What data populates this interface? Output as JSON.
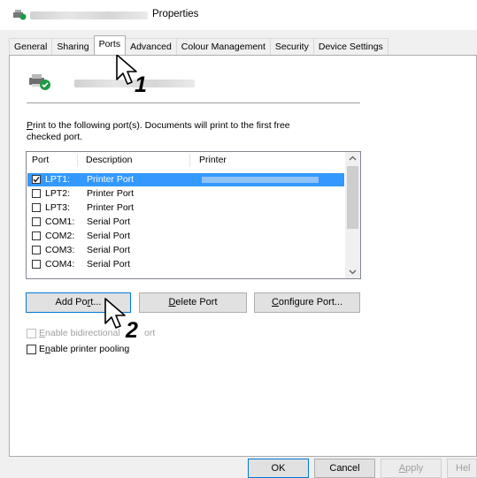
{
  "window": {
    "title_suffix": "Properties",
    "tabs": [
      {
        "label": "General"
      },
      {
        "label": "Sharing"
      },
      {
        "label": "Ports"
      },
      {
        "label": "Advanced"
      },
      {
        "label": "Colour Management"
      },
      {
        "label": "Security"
      },
      {
        "label": "Device Settings"
      }
    ],
    "active_tab": "Ports"
  },
  "ports_tab": {
    "instruction_line1_key": "P",
    "instruction_line1_rest": "rint to the following port(s). Documents will print to the first free",
    "instruction_line2": "checked port.",
    "columns": [
      "Port",
      "Description",
      "Printer"
    ],
    "rows": [
      {
        "port": "LPT1:",
        "description": "Printer Port",
        "checked": true,
        "selected": true
      },
      {
        "port": "LPT2:",
        "description": "Printer Port",
        "checked": false,
        "selected": false
      },
      {
        "port": "LPT3:",
        "description": "Printer Port",
        "checked": false,
        "selected": false
      },
      {
        "port": "COM1:",
        "description": "Serial Port",
        "checked": false,
        "selected": false
      },
      {
        "port": "COM2:",
        "description": "Serial Port",
        "checked": false,
        "selected": false
      },
      {
        "port": "COM3:",
        "description": "Serial Port",
        "checked": false,
        "selected": false
      },
      {
        "port": "COM4:",
        "description": "Serial Port",
        "checked": false,
        "selected": false
      }
    ],
    "buttons": {
      "add_pre": "Add Po",
      "add_key": "r",
      "add_post": "t...",
      "delete_key": "D",
      "delete_post": "elete Port",
      "configure_key": "C",
      "configure_post": "onfigure Port..."
    },
    "bidirectional": {
      "key": "E",
      "rest": "nable bidirectional",
      "tail": "ort",
      "checked": false,
      "enabled": false
    },
    "pooling": {
      "pre": "E",
      "key": "n",
      "post": "able printer pooling",
      "checked": false
    }
  },
  "footer": {
    "ok": "OK",
    "cancel": "Cancel",
    "apply_key": "A",
    "apply_post": "pply",
    "help": "Hel"
  },
  "annotations": {
    "step1": "1",
    "step2": "2"
  },
  "colors": {
    "selection": "#3399ff",
    "accent_border": "#0078d7",
    "dialog_bg": "#f0f0f0"
  }
}
